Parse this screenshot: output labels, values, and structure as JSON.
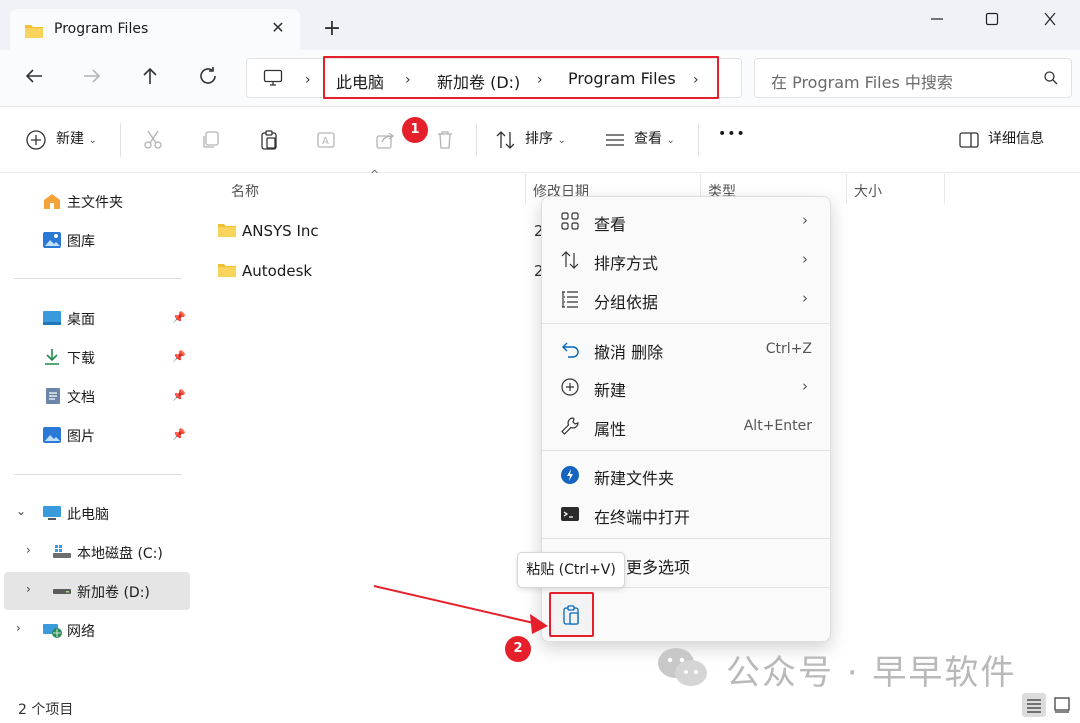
{
  "window": {
    "tab_title": "Program Files",
    "new_tab": "+",
    "close_tab": "✕",
    "controls": {
      "minimize": "—",
      "maximize": "☐",
      "close": "✕"
    }
  },
  "address": {
    "crumbs": [
      "此电脑",
      "新加卷 (D:)",
      "Program Files"
    ],
    "search_placeholder": "在 Program Files 中搜索"
  },
  "toolbar": {
    "new_label": "新建",
    "sort_label": "排序",
    "view_label": "查看",
    "more_label": "•••",
    "details_label": "详细信息",
    "badge1": "1"
  },
  "sidebar": {
    "home": "主文件夹",
    "gallery": "图库",
    "desktop": "桌面",
    "downloads": "下载",
    "documents": "文档",
    "pictures": "图片",
    "this_pc": "此电脑",
    "drive_c": "本地磁盘 (C:)",
    "drive_d": "新加卷 (D:)",
    "network": "网络"
  },
  "columns": {
    "name": "名称",
    "modified": "修改日期",
    "type": "类型",
    "size": "大小"
  },
  "files": [
    {
      "name": "ANSYS Inc",
      "date": "2"
    },
    {
      "name": "Autodesk",
      "date": "2"
    }
  ],
  "context_menu": {
    "view": "查看",
    "sort_by": "排序方式",
    "group_by": "分组依据",
    "undo_delete": "撤消 删除",
    "undo_shortcut": "Ctrl+Z",
    "new": "新建",
    "properties": "属性",
    "properties_shortcut": "Alt+Enter",
    "new_folder": "新建文件夹",
    "open_terminal": "在终端中打开",
    "more_options": "显示更多选项"
  },
  "tooltip": "粘贴 (Ctrl+V)",
  "badge2": "2",
  "status": {
    "count": "2 个项目"
  },
  "watermark": "公众号 · 早早软件",
  "colors": {
    "highlight": "#e5202a",
    "folder": "#f4c038",
    "accent": "#0067c0"
  }
}
